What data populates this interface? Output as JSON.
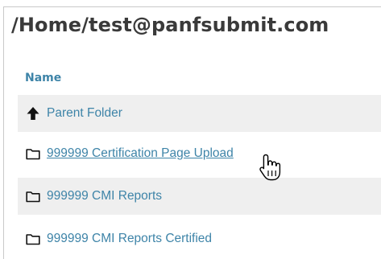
{
  "header": {
    "path_title": "/Home/test@panfsubmit.com"
  },
  "table": {
    "column_name": "Name"
  },
  "rows": [
    {
      "label": "Parent Folder",
      "icon": "arrow-up-icon"
    },
    {
      "label": "999999 Certification Page Upload",
      "icon": "folder-icon"
    },
    {
      "label": "999999 CMI Reports",
      "icon": "folder-icon"
    },
    {
      "label": "999999 CMI Reports Certified",
      "icon": "folder-icon"
    }
  ],
  "colors": {
    "link": "#3e84a8",
    "row_shade": "#efefef",
    "title": "#3a3a3a"
  },
  "cursor": {
    "icon": "hand-pointer-icon"
  }
}
